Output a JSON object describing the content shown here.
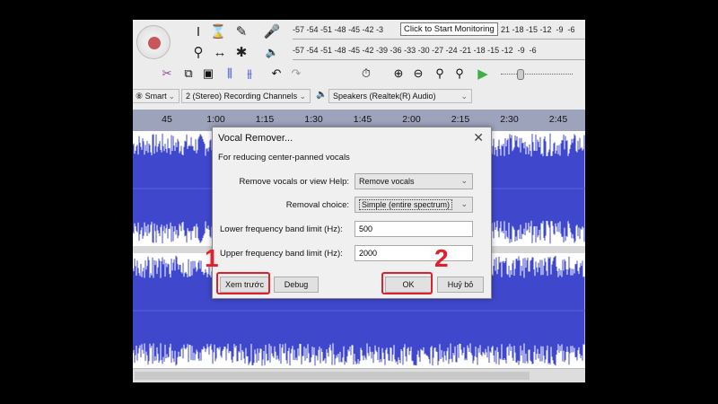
{
  "toolbar": {
    "meter_record": "-57 -54 -51 -48 -45 -42 -3",
    "meter_record_end": "21 -18 -15 -12  -9  -6",
    "meter_play": "-57 -54 -51 -48 -45 -42 -39 -36 -33 -30 -27 -24 -21 -18 -15 -12  -9  -6",
    "monitor_tooltip": "Click to Start Monitoring",
    "rate_select": "⑧ Smart",
    "channels_select": "2 (Stereo) Recording Channels",
    "output_device": "Speakers (Realtek(R) Audio)"
  },
  "ruler": {
    "ticks": [
      "45",
      "1:00",
      "1:15",
      "1:30",
      "1:45",
      "2:00",
      "2:15",
      "2:30",
      "2:45"
    ]
  },
  "dialog": {
    "title": "Vocal Remover...",
    "description": "For reducing center-panned vocals",
    "remove_label": "Remove vocals or view Help:",
    "remove_value": "Remove vocals",
    "choice_label": "Removal choice:",
    "choice_value": "Simple (entire spectrum)",
    "lower_label": "Lower frequency band limit (Hz):",
    "lower_value": "500",
    "upper_label": "Upper frequency band limit (Hz):",
    "upper_value": "2000",
    "preview": "Xem trước",
    "debug": "Debug",
    "ok": "OK",
    "cancel": "Huỷ bỏ"
  },
  "annotations": {
    "step1": "1",
    "step2": "2",
    "color": "#e0202c"
  },
  "colors": {
    "waveform": "#3f48cc",
    "ruler": "#9ea3bc"
  }
}
